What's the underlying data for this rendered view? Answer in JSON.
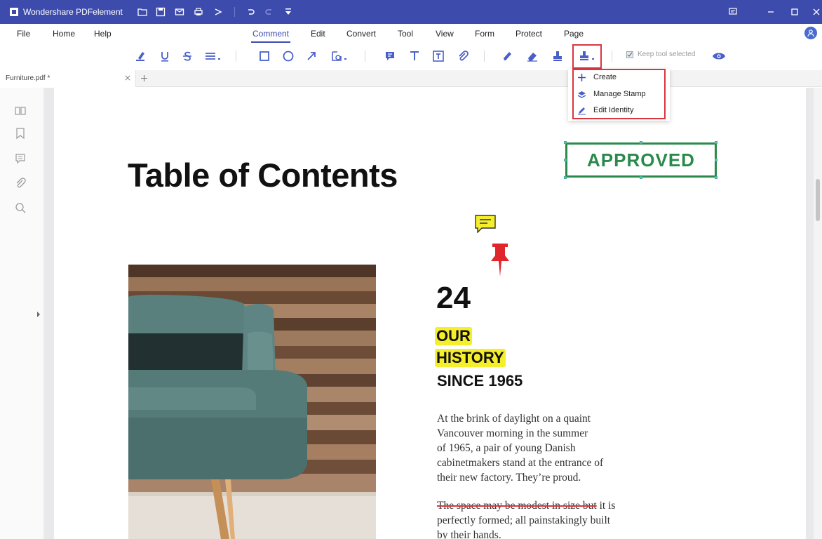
{
  "app": {
    "title": "Wondershare PDFelement"
  },
  "menu": {
    "items": [
      "File",
      "Home",
      "Help",
      "Comment",
      "Edit",
      "Convert",
      "Tool",
      "View",
      "Form",
      "Protect",
      "Page"
    ],
    "active": "Comment"
  },
  "toolbar": {
    "keep_tool_label": "Keep tool selected",
    "keep_tool_checked": true
  },
  "stamp_menu": {
    "items": [
      {
        "label": "Create",
        "icon": "plus-icon"
      },
      {
        "label": "Manage Stamp",
        "icon": "stamp-stack-icon"
      },
      {
        "label": "Edit Identity",
        "icon": "pen-icon"
      }
    ]
  },
  "tab": {
    "filename": "Furniture.pdf *"
  },
  "document": {
    "title": "Table of Contents",
    "stamp_text": "APPROVED",
    "page_number": "24",
    "heading_line1": "OUR",
    "heading_line2": "HISTORY",
    "heading_line3": "SINCE 1965",
    "para1": [
      "At the brink of daylight on a quaint",
      "Vancouver morning in the summer",
      "of 1965, a pair of young Danish",
      "cabinetmakers stand at the entrance of",
      "their new factory. They’re proud."
    ],
    "para2_strike": "The space may be modest in size but",
    "para2_rest": " it is",
    "para2": [
      "perfectly formed; all painstakingly built",
      "by their hands."
    ]
  },
  "colors": {
    "titlebar": "#3d4bad",
    "accent": "#3d4bad",
    "highlight": "#f5ee2a",
    "stamp_green": "#2a8a4c",
    "callout_red": "#d9363e"
  }
}
